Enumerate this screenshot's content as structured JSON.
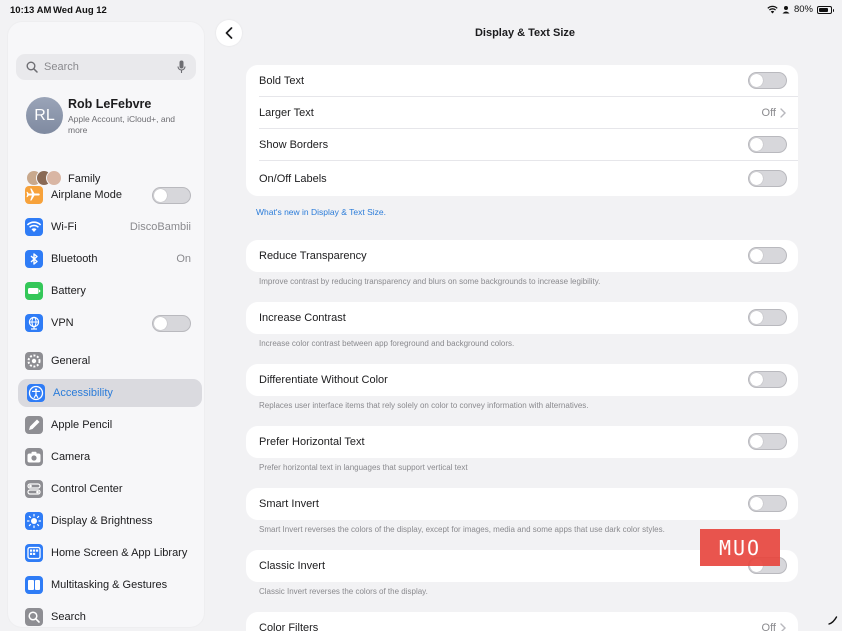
{
  "status_bar": {
    "time": "10:13 AM",
    "date": "Wed Aug 12",
    "battery": "80%",
    "battery_level": 0.8
  },
  "sidebar": {
    "search_placeholder": "Search",
    "profile": {
      "initials": "RL",
      "name": "Rob LeFebvre",
      "subtitle": "Apple Account, iCloud+, and more"
    },
    "family_label": "Family",
    "group1": [
      {
        "label": "Airplane Mode",
        "icon": "airplane-icon",
        "color": "#f7a23b",
        "toggle": false
      },
      {
        "label": "Wi-Fi",
        "icon": "wifi-icon",
        "color": "#2f7cf6",
        "value": "DiscoBambii"
      },
      {
        "label": "Bluetooth",
        "icon": "bluetooth-icon",
        "color": "#2f7cf6",
        "value": "On"
      },
      {
        "label": "Battery",
        "icon": "battery-icon",
        "color": "#34c759"
      },
      {
        "label": "VPN",
        "icon": "vpn-icon",
        "color": "#2f7cf6",
        "toggle": false
      }
    ],
    "group2": [
      {
        "label": "General",
        "icon": "gear-icon",
        "color": "#8e8e93"
      },
      {
        "label": "Accessibility",
        "icon": "accessibility-icon",
        "color": "#2f7cf6",
        "selected": true
      },
      {
        "label": "Apple Pencil",
        "icon": "pencil-icon",
        "color": "#8e8e93"
      },
      {
        "label": "Camera",
        "icon": "camera-icon",
        "color": "#8e8e93"
      },
      {
        "label": "Control Center",
        "icon": "control-center-icon",
        "color": "#8e8e93"
      },
      {
        "label": "Display & Brightness",
        "icon": "brightness-icon",
        "color": "#2f7cf6"
      },
      {
        "label": "Home Screen & App Library",
        "icon": "home-screen-icon",
        "color": "#2f7cf6"
      },
      {
        "label": "Multitasking & Gestures",
        "icon": "multitasking-icon",
        "color": "#2f7cf6"
      },
      {
        "label": "Search",
        "icon": "search-icon",
        "color": "#8e8e93"
      }
    ]
  },
  "main": {
    "title": "Display & Text Size",
    "group1": [
      {
        "label": "Bold Text",
        "toggle": false
      },
      {
        "label": "Larger Text",
        "value": "Off"
      },
      {
        "label": "Show Borders",
        "toggle": false
      },
      {
        "label": "On/Off Labels",
        "toggle": false
      }
    ],
    "whats_new_link": "What's new in Display & Text Size.",
    "settings": [
      {
        "label": "Reduce Transparency",
        "toggle": false,
        "note": "Improve contrast by reducing transparency and blurs on some backgrounds to increase legibility."
      },
      {
        "label": "Increase Contrast",
        "toggle": false,
        "note": "Increase color contrast between app foreground and background colors."
      },
      {
        "label": "Differentiate Without Color",
        "toggle": false,
        "note": "Replaces user interface items that rely solely on color to convey information with alternatives."
      },
      {
        "label": "Prefer Horizontal Text",
        "toggle": false,
        "note": "Prefer horizontal text in languages that support vertical text"
      },
      {
        "label": "Smart Invert",
        "toggle": false,
        "note": "Smart Invert reverses the colors of the display, except for images, media and some apps that use dark color styles."
      },
      {
        "label": "Classic Invert",
        "toggle": false,
        "note": "Classic Invert reverses the colors of the display."
      }
    ],
    "color_filters": {
      "label": "Color Filters",
      "value": "Off"
    }
  },
  "watermark": "MUO"
}
